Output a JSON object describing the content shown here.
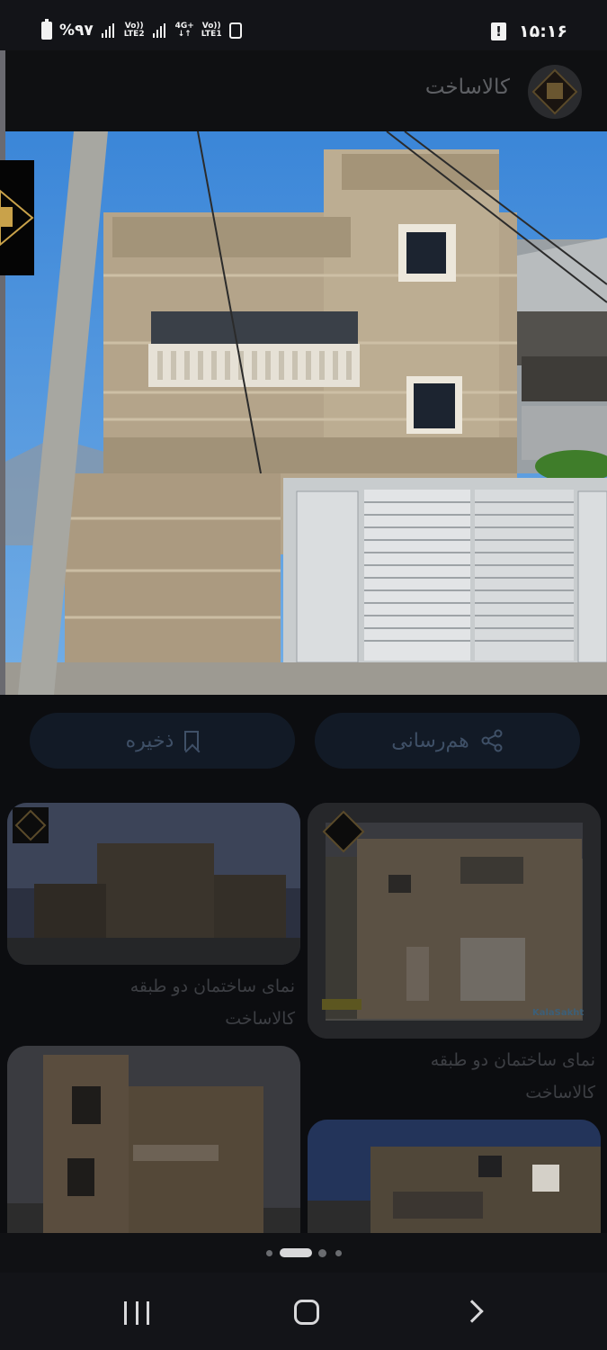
{
  "status_bar": {
    "battery": "%۹۷",
    "signal_1": [
      "Vo))",
      "LTE2"
    ],
    "network": [
      "4G+",
      "↓↑"
    ],
    "signal_2": [
      "Vo))",
      "LTE1"
    ],
    "time": "۱۵:۱۶",
    "warning": "!"
  },
  "app_bar": {
    "title": "کالاساخت"
  },
  "actions": {
    "save_label": "ذخیره",
    "share_label": "هم‌رسانی"
  },
  "grid": {
    "cards": [
      {
        "caption_line1": "نمای ساختمان دو طبقه",
        "caption_line2": "کالاساخت"
      },
      {
        "caption_line1": "نمای ساختمان دو طبقه",
        "caption_line2": "کالاساخت"
      },
      {
        "caption_line1": "",
        "caption_line2": ""
      },
      {
        "caption_line1": "",
        "caption_line2": ""
      }
    ],
    "watermark": "KalaSakht"
  },
  "pager": {
    "count": 4,
    "active": 1
  }
}
